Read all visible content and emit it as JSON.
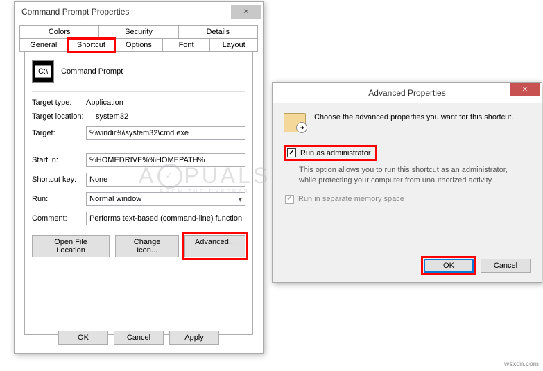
{
  "main": {
    "title": "Command Prompt Properties",
    "tabs_row1": [
      "Colors",
      "Security",
      "Details"
    ],
    "tabs_row2": [
      "General",
      "Shortcut",
      "Options",
      "Font",
      "Layout"
    ],
    "active_tab": "Shortcut",
    "app_name": "Command Prompt",
    "fields": {
      "target_type_label": "Target type:",
      "target_type_value": "Application",
      "target_location_label": "Target location:",
      "target_location_value": "system32",
      "target_label": "Target:",
      "target_value": "%windir%\\system32\\cmd.exe",
      "start_in_label": "Start in:",
      "start_in_value": "%HOMEDRIVE%%HOMEPATH%",
      "shortcut_key_label": "Shortcut key:",
      "shortcut_key_value": "None",
      "run_label": "Run:",
      "run_value": "Normal window",
      "comment_label": "Comment:",
      "comment_value": "Performs text-based (command-line) functions."
    },
    "buttons": {
      "open_location": "Open File Location",
      "change_icon": "Change Icon...",
      "advanced": "Advanced..."
    },
    "footer": {
      "ok": "OK",
      "cancel": "Cancel",
      "apply": "Apply"
    }
  },
  "adv": {
    "title": "Advanced Properties",
    "intro": "Choose the advanced properties you want for this shortcut.",
    "run_admin_label": "Run as administrator",
    "run_admin_desc": "This option allows you to run this shortcut as an administrator, while protecting your computer from unauthorized activity.",
    "separate_mem_label": "Run in separate memory space",
    "ok": "OK",
    "cancel": "Cancel"
  },
  "watermark": {
    "main": "A  PPUALS",
    "sub": "FROM  THE  EXPERTS"
  },
  "credit": "wsxdn.com"
}
